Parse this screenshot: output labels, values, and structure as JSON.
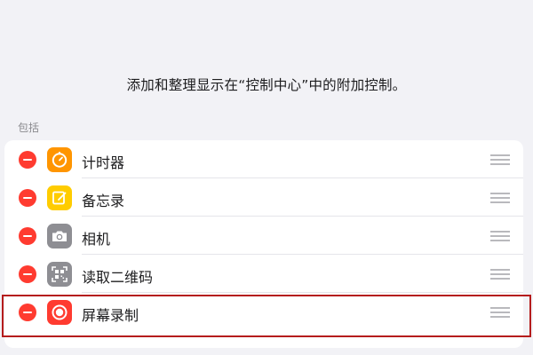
{
  "description": "添加和整理显示在“控制中心”中的附加控制。",
  "section_header": "包括",
  "controls": [
    {
      "label": "计时器",
      "icon": "timer-icon",
      "icon_color": "#ff9500"
    },
    {
      "label": "备忘录",
      "icon": "notes-icon",
      "icon_color": "#ffcc00"
    },
    {
      "label": "相机",
      "icon": "camera-icon",
      "icon_color": "#8e8e93"
    },
    {
      "label": "读取二维码",
      "icon": "qr-code-icon",
      "icon_color": "#8e8e93"
    },
    {
      "label": "屏幕录制",
      "icon": "screen-recording-icon",
      "icon_color": "#ff3b30"
    }
  ],
  "colors": {
    "background": "#f2f2f6",
    "remove_button": "#ff3b30",
    "highlight_border": "#b51c1c"
  }
}
